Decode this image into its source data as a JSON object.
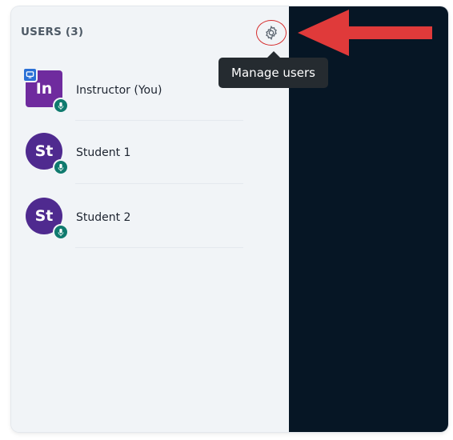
{
  "users_panel": {
    "title": "USERS (3)",
    "settings_icon": "gear-icon",
    "tooltip": "Manage users",
    "users": [
      {
        "initials": "In",
        "name": "Instructor (You)",
        "avatar_shape": "square",
        "avatar_color": "#6f2b9e",
        "presenter": true,
        "status_icon": "microphone-icon"
      },
      {
        "initials": "St",
        "name": "Student 1",
        "avatar_shape": "round",
        "avatar_color": "#4f2a8f",
        "presenter": false,
        "status_icon": "microphone-icon"
      },
      {
        "initials": "St",
        "name": "Student 2",
        "avatar_shape": "round",
        "avatar_color": "#4f2a8f",
        "presenter": false,
        "status_icon": "microphone-icon"
      }
    ]
  },
  "annotation": {
    "arrow_icon": "arrow-left-icon",
    "arrow_color": "#e03a3a",
    "highlight_color": "#d62c2c"
  },
  "colors": {
    "panel_bg": "#f1f4f7",
    "dark_bg": "#061625",
    "badge_green": "#0f7a6e",
    "presenter_blue": "#2a70d6"
  }
}
